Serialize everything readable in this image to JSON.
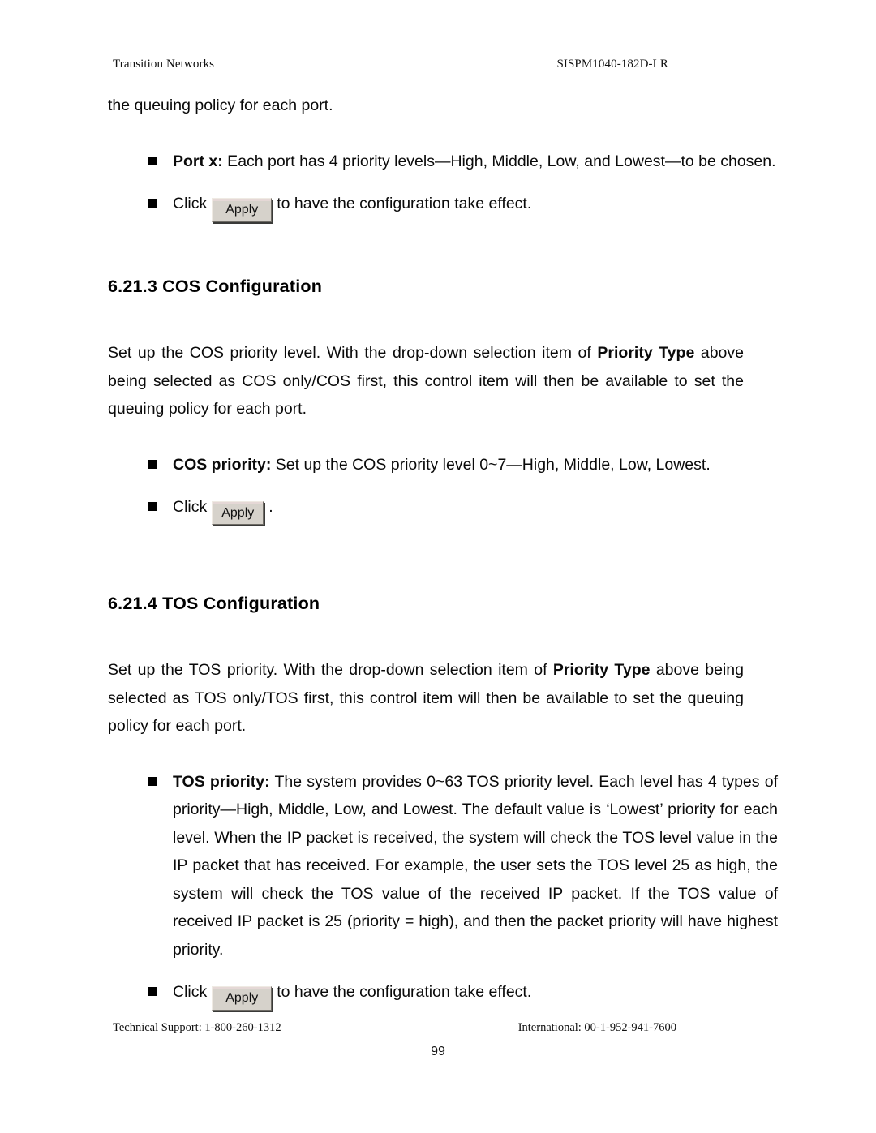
{
  "header": {
    "left": "Transition Networks",
    "right": "SISPM1040-182D-LR"
  },
  "content": {
    "continued_paragraph": "the queuing policy for each port.",
    "port_bullet": {
      "label": "Port x:",
      "text": " Each port has 4 priority levels—High, Middle, Low, and Lowest—to be chosen."
    },
    "click_apply_bullet_1": {
      "pre": "Click",
      "button_label": "Apply",
      "post": "to have the configuration take effect."
    },
    "cos_section": {
      "heading": "6.21.3 COS Configuration",
      "paragraph_part1": "Set up the COS priority level. With the drop-down selection item of ",
      "paragraph_bold": "Priority Type",
      "paragraph_part2": " above being selected as COS only/COS first, this control item will then be available to set the queuing policy for each port.",
      "cos_priority_bullet": {
        "label": "COS priority:",
        "text": " Set up the COS priority level 0~7—High, Middle, Low, Lowest."
      },
      "click_apply_bullet": {
        "pre": "Click",
        "button_label": "Apply",
        "post": "."
      }
    },
    "tos_section": {
      "heading": "6.21.4 TOS Configuration",
      "paragraph_part1": "Set up the TOS priority. With the drop-down selection item of ",
      "paragraph_bold": "Priority Type",
      "paragraph_part2": " above being selected as TOS only/TOS first, this control item will then be available to set the queuing policy for each port.",
      "tos_priority_bullet": {
        "label": "TOS priority:",
        "text": " The system provides 0~63 TOS priority level. Each level has 4 types of priority—High, Middle, Low, and Lowest. The default value is ‘Lowest’ priority for each level. When the IP packet is received, the system will check the TOS level value in the IP packet that has received. For example, the user sets the TOS level 25 as high, the system will check the TOS value of the received IP packet. If the TOS value of received IP packet is 25 (priority = high), and then the packet priority will have highest priority."
      },
      "click_apply_bullet": {
        "pre": "Click",
        "button_label": "Apply",
        "post": "to have the configuration take effect."
      }
    }
  },
  "footer": {
    "technical_support": "Technical Support: 1-800-260-1312",
    "international": "International: 00-1-952-941-7600",
    "page_number": "99"
  }
}
